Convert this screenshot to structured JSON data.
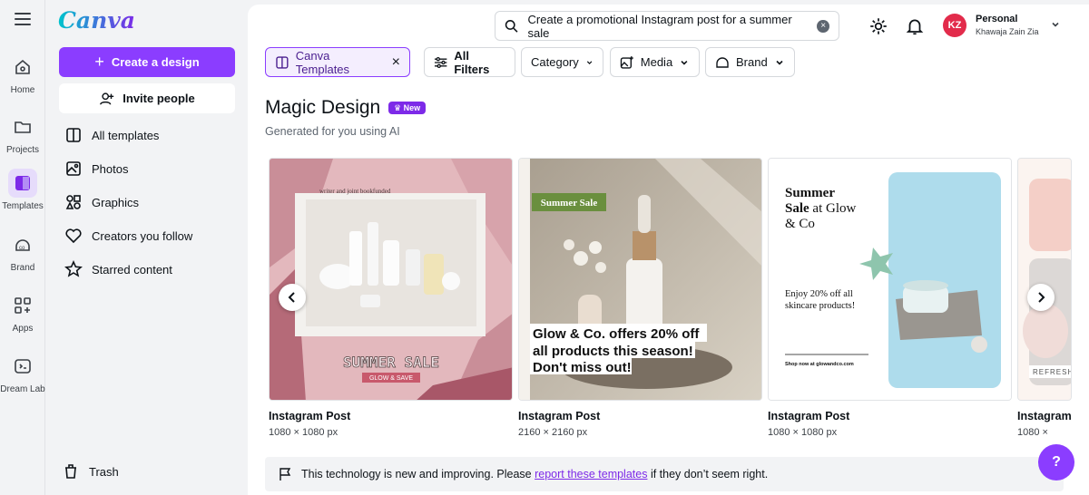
{
  "app": {
    "logo_text": "Canva",
    "brand_color": "#8b3dff"
  },
  "rail": {
    "items": [
      {
        "label": "Home",
        "icon": "home-icon"
      },
      {
        "label": "Projects",
        "icon": "folder-icon"
      },
      {
        "label": "Templates",
        "icon": "templates-icon",
        "active": true
      },
      {
        "label": "Brand",
        "icon": "brand-icon"
      },
      {
        "label": "Apps",
        "icon": "apps-icon"
      },
      {
        "label": "Dream Lab",
        "icon": "dream-lab-icon"
      }
    ]
  },
  "panel": {
    "create_label": "Create a design",
    "invite_label": "Invite people",
    "nav": [
      {
        "label": "All templates",
        "icon": "template-grid-icon"
      },
      {
        "label": "Photos",
        "icon": "photo-icon"
      },
      {
        "label": "Graphics",
        "icon": "graphics-icon"
      },
      {
        "label": "Creators you follow",
        "icon": "heart-icon"
      },
      {
        "label": "Starred content",
        "icon": "star-icon"
      }
    ],
    "trash_label": "Trash"
  },
  "header": {
    "search_value": "Create a promotional Instagram post for a summer sale",
    "account_initials": "KZ",
    "account_type": "Personal",
    "account_name": "Khawaja Zain Zia"
  },
  "filters": {
    "canva_templates": "Canva Templates",
    "all_filters": "All Filters",
    "category": "Category",
    "media": "Media",
    "brand": "Brand"
  },
  "magic_design": {
    "title": "Magic Design",
    "badge": "New",
    "subtitle": "Generated for you using AI"
  },
  "templates": [
    {
      "type": "Instagram Post",
      "size": "1080 × 1080 px",
      "headline": "SUMMER SALE",
      "tagline": "GLOW & SAVE",
      "top_text": "writer and joint bookfunded"
    },
    {
      "type": "Instagram Post",
      "size": "2160 × 2160 px",
      "tag": "Summer Sale",
      "line1": "Glow & Co. offers 20% off",
      "line2": "all products this season!",
      "line3": "Don't miss out!"
    },
    {
      "type": "Instagram Post",
      "size": "1080 × 1080 px",
      "title_bold_1": "Summer",
      "title_bold_2": "Sale",
      "title_rest_1": " at Glow",
      "title_rest_2": "& Co",
      "body": "Enjoy 20% off all skincare products!",
      "footer": "Shop now at glowandco.com"
    },
    {
      "type": "Instagram",
      "size": "1080 ×",
      "badge": "REFRESH"
    }
  ],
  "notice": {
    "pre": "This technology is new and improving. Please ",
    "link": "report these templates",
    "post": " if they don’t seem right."
  },
  "help_label": "?"
}
